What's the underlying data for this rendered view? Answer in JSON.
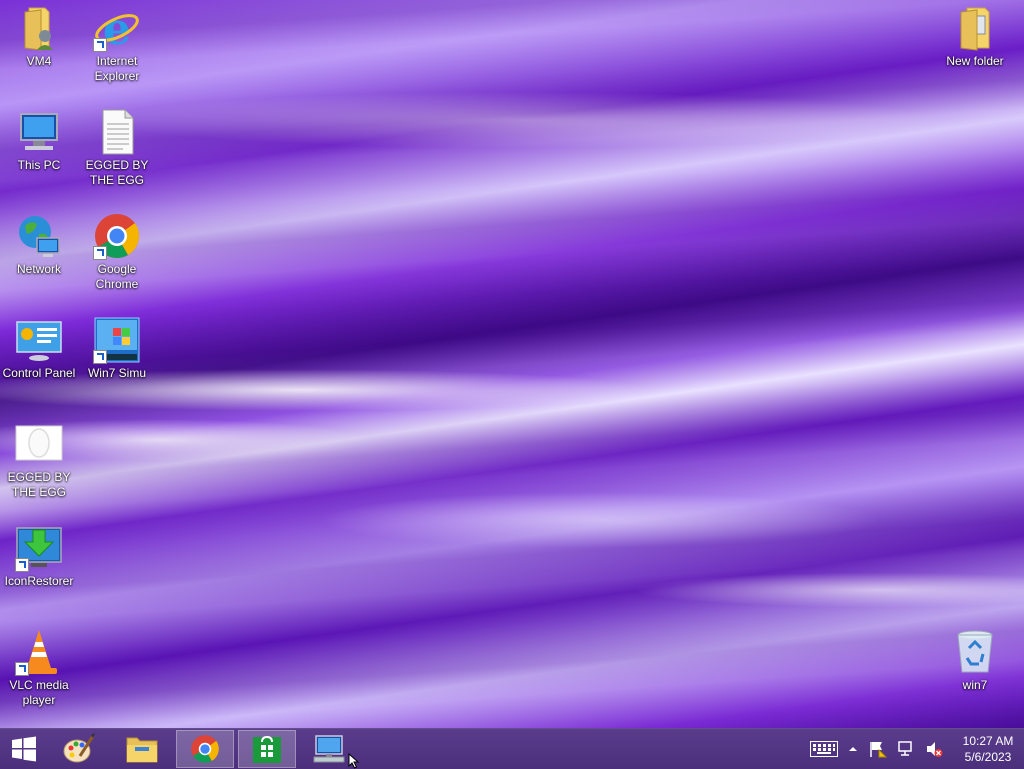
{
  "desktop": {
    "icons": [
      {
        "label": "VM4"
      },
      {
        "label": "Internet Explorer"
      },
      {
        "label": "This PC"
      },
      {
        "label": "EGGED BY THE EGG"
      },
      {
        "label": "Network"
      },
      {
        "label": "Google Chrome"
      },
      {
        "label": "Control Panel"
      },
      {
        "label": "Win7 Simu"
      },
      {
        "label": "EGGED BY THE EGG"
      },
      {
        "label": "IconRestorer"
      },
      {
        "label": "VLC media player"
      },
      {
        "label": "New folder"
      },
      {
        "label": "win7"
      }
    ]
  },
  "taskbar": {
    "items": [
      {
        "name": "start-button-icon"
      },
      {
        "name": "paint-icon"
      },
      {
        "name": "file-explorer-icon"
      },
      {
        "name": "chrome-icon"
      },
      {
        "name": "store-icon"
      },
      {
        "name": "remote-desktop-icon"
      }
    ],
    "clock": {
      "time": "10:27 AM",
      "date": "5/6/2023"
    }
  },
  "colors": {
    "taskbar": "#4b2f7b",
    "accent": "#7a2fd6"
  }
}
